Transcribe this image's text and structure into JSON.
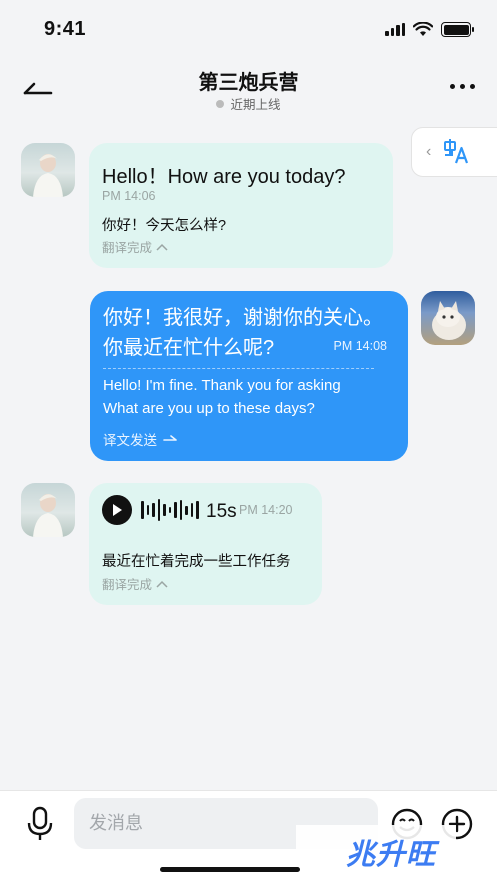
{
  "status_bar": {
    "time": "9:41"
  },
  "header": {
    "title": "第三炮兵营",
    "status": "近期上线"
  },
  "messages": [
    {
      "direction": "incoming",
      "text": "Hello！How are you today?",
      "time": "PM 14:06",
      "translation": "你好！今天怎么样?",
      "translate_state": "翻译完成"
    },
    {
      "direction": "outgoing",
      "text_line1": "你好！我很好，谢谢你的关心。",
      "text_line2": "你最近在忙什么呢?",
      "time": "PM 14:08",
      "translation_line1": "Hello! I'm fine. Thank you for asking",
      "translation_line2": "What are you up to these days?",
      "translate_state": "译文发送"
    },
    {
      "direction": "incoming",
      "type": "voice",
      "duration": "15s",
      "time": "PM 14:20",
      "transcript": "最近在忙着完成一些工作任务",
      "translate_state": "翻译完成"
    }
  ],
  "input": {
    "placeholder": "发消息"
  },
  "watermark": {
    "text": "兆升旺"
  }
}
